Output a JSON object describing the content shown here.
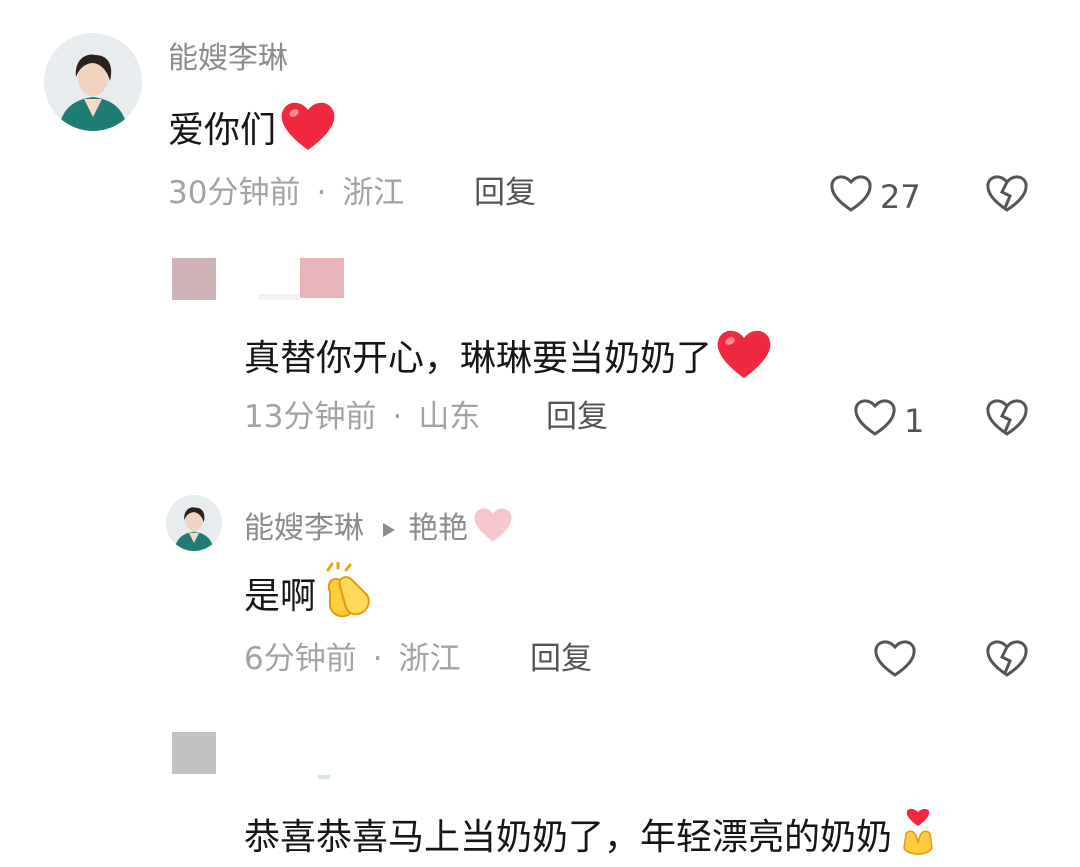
{
  "comments": [
    {
      "author": "能嫂李琳",
      "text": "爱你们",
      "time": "30分钟前",
      "location": "浙江",
      "reply_label": "回复",
      "likes": "27"
    },
    {
      "author": "",
      "text": "真替你开心，琳琳要当奶奶了",
      "time": "13分钟前",
      "location": "山东",
      "reply_label": "回复",
      "likes": "1"
    },
    {
      "author": "能嫂李琳",
      "reply_to": "艳艳",
      "text": "是啊",
      "time": "6分钟前",
      "location": "浙江",
      "reply_label": "回复",
      "likes": ""
    },
    {
      "author": "",
      "text": "恭喜恭喜马上当奶奶了，年轻漂亮的奶奶"
    }
  ],
  "separator": "·",
  "colors": {
    "heart_red": "#f0293e",
    "meta_gray": "#a3a3a3",
    "name_gray": "#8c8c8c",
    "text_dark": "#161616",
    "mosaic_pink": "#e2b1b6"
  },
  "icons": [
    "heart-outline-icon",
    "broken-heart-icon",
    "red-heart-emoji",
    "clapping-hands-emoji",
    "pink-heart-emoji",
    "reply-arrow-icon"
  ]
}
